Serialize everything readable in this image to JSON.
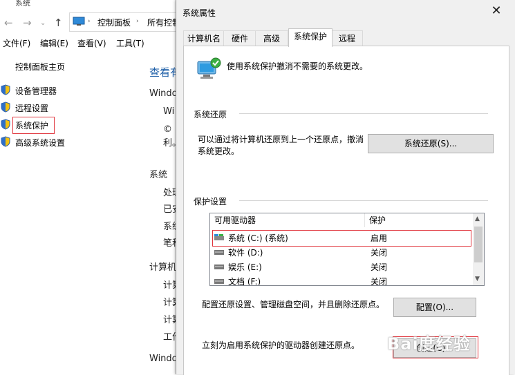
{
  "background": {
    "title_fragment": "系统",
    "breadcrumb": [
      "控制面板",
      "所有控制"
    ],
    "menu": [
      "文件(F)",
      "编辑(E)",
      "查看(V)",
      "工具(T)"
    ],
    "sidebar_home": "控制面板主页",
    "sidebar_links": [
      "设备管理器",
      "远程设置",
      "系统保护",
      "高级系统设置"
    ],
    "content_fragments": {
      "heading": "查看有",
      "windows_edition": "Windo",
      "win": "Wi",
      "copyright": "©",
      "li": "利。",
      "system": "系统",
      "chu": "处理",
      "yi": "已安",
      "xi": "系统",
      "bi": "笔和",
      "computer": "计算机名",
      "ji1": "计算",
      "ji2": "计算",
      "ji3": "计算",
      "gong": "工作",
      "windows_activation": "Windo",
      "big_letter": "V"
    }
  },
  "dialog": {
    "title": "系统属性",
    "close_glyph": "✕",
    "tabs": [
      "计算机名",
      "硬件",
      "高级",
      "系统保护",
      "远程"
    ],
    "active_tab": "系统保护",
    "intro": "使用系统保护撤消不需要的系统更改。",
    "restore": {
      "heading": "系统还原",
      "description_line1": "可以通过将计算机还原到上一个还原点，撤消",
      "description_line2": "系统更改。",
      "button": "系统还原(S)..."
    },
    "protection": {
      "heading": "保护设置",
      "col_drive": "可用驱动器",
      "col_protection": "保护",
      "drives": [
        {
          "name": "系统 (C:) (系统)",
          "protection": "启用"
        },
        {
          "name": "软件 (D:)",
          "protection": "关闭"
        },
        {
          "name": "娱乐 (E:)",
          "protection": "关闭"
        },
        {
          "name": "文档 (F:)",
          "protection": "关闭"
        }
      ]
    },
    "configure": {
      "description": "配置还原设置、管理磁盘空间，并且删除还原点。",
      "button": "配置(O)..."
    },
    "create": {
      "description": "立刻为启用系统保护的驱动器创建还原点。",
      "button": "创建(C)..."
    }
  },
  "watermark": "Bai度经验",
  "colors": {
    "highlight_red": "#e0343c",
    "dialog_bg": "#f0f0f0",
    "link_blue": "#1e5fa8"
  }
}
